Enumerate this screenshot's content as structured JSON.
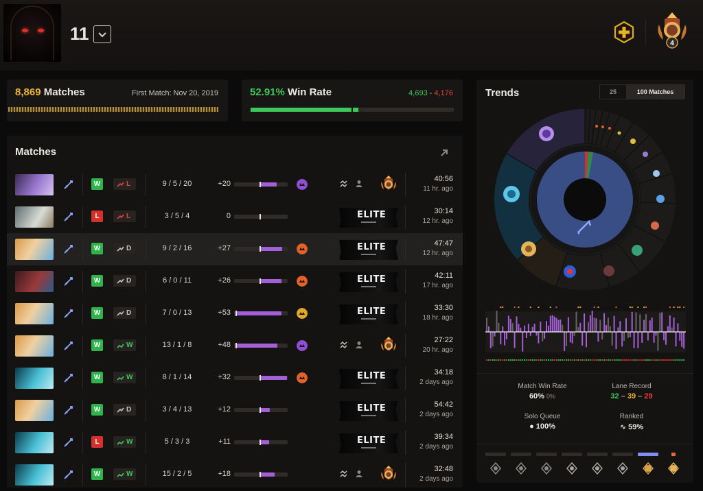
{
  "header": {
    "player_name": "11",
    "rank_number": "4"
  },
  "summary": {
    "matches_count": "8,869",
    "matches_label": " Matches",
    "first_match": "First Match: Nov 20, 2019",
    "win_rate": "52.91%",
    "win_rate_label": " Win Rate",
    "wins": "4,693",
    "losses": "4,176",
    "win_fraction": 0.5291
  },
  "matches": {
    "title": "Matches",
    "rows": [
      {
        "hero": "hero-a",
        "color": "#7a4bb3",
        "result": "W",
        "lane": "L",
        "lane_type": "loss",
        "kda": "9 / 5 / 20",
        "impact": "+20",
        "impact_value": 20,
        "role_color": "#8e4fd6",
        "mode": "party-ranked",
        "duration": "40:56",
        "ago": "11 hr. ago"
      },
      {
        "hero": "hero-b",
        "color": "#6e7f8c",
        "result": "L",
        "lane": "L",
        "lane_type": "loss",
        "kda": "3 / 5 / 4",
        "impact": "0",
        "impact_value": 0,
        "role_color": "",
        "mode": "elite",
        "duration": "30:14",
        "ago": "12 hr. ago"
      },
      {
        "hero": "hero-c",
        "color": "#c98a45",
        "result": "W",
        "lane": "D",
        "lane_type": "draw",
        "kda": "9 / 2 / 16",
        "impact": "+27",
        "impact_value": 27,
        "role_color": "#e2622a",
        "mode": "elite",
        "duration": "47:47",
        "ago": "12 hr. ago"
      },
      {
        "hero": "hero-d",
        "color": "#8a3a3a",
        "result": "W",
        "lane": "D",
        "lane_type": "draw",
        "kda": "6 / 0 / 11",
        "impact": "+26",
        "impact_value": 26,
        "role_color": "#e2622a",
        "mode": "elite",
        "duration": "42:11",
        "ago": "17 hr. ago"
      },
      {
        "hero": "hero-c",
        "color": "#c98a45",
        "result": "W",
        "lane": "D",
        "lane_type": "draw",
        "kda": "7 / 0 / 13",
        "impact": "+53",
        "impact_value": 53,
        "role_color": "#e0a82a",
        "mode": "elite",
        "duration": "33:30",
        "ago": "18 hr. ago"
      },
      {
        "hero": "hero-c",
        "color": "#c98a45",
        "result": "W",
        "lane": "W",
        "lane_type": "win",
        "kda": "13 / 1 / 8",
        "impact": "+48",
        "impact_value": 48,
        "role_color": "#8e4fd6",
        "mode": "party-ranked",
        "duration": "27:22",
        "ago": "20 hr. ago"
      },
      {
        "hero": "hero-e",
        "color": "#2a8fa8",
        "result": "W",
        "lane": "W",
        "lane_type": "win",
        "kda": "8 / 1 / 14",
        "impact": "+32",
        "impact_value": 32,
        "role_color": "#e2622a",
        "mode": "elite",
        "duration": "34:18",
        "ago": "2 days ago"
      },
      {
        "hero": "hero-c",
        "color": "#c98a45",
        "result": "W",
        "lane": "D",
        "lane_type": "draw",
        "kda": "3 / 4 / 13",
        "impact": "+12",
        "impact_value": 12,
        "role_color": "",
        "mode": "elite",
        "duration": "54:42",
        "ago": "2 days ago"
      },
      {
        "hero": "hero-e",
        "color": "#2a8fa8",
        "result": "L",
        "lane": "W",
        "lane_type": "win",
        "kda": "5 / 3 / 3",
        "impact": "+11",
        "impact_value": 11,
        "role_color": "",
        "mode": "elite",
        "duration": "39:34",
        "ago": "2 days ago"
      },
      {
        "hero": "hero-e",
        "color": "#2a8fa8",
        "result": "W",
        "lane": "W",
        "lane_type": "win",
        "kda": "15 / 2 / 5",
        "impact": "+18",
        "impact_value": 18,
        "role_color": "",
        "mode": "party-ranked",
        "duration": "32:48",
        "ago": "2 days ago"
      }
    ],
    "elite_text": "ELITE"
  },
  "trends": {
    "title": "Trends",
    "tab_25": "25",
    "tab_100": "100 Matches",
    "stats": {
      "match_win_rate_label": "Match Win Rate",
      "match_win_rate": "60%",
      "match_win_rate_sub": "0%",
      "lane_record_label": "Lane Record",
      "lane_w": "32",
      "lane_d": "39",
      "lane_l": "29",
      "solo_label": "Solo Queue",
      "solo_value": "100%",
      "ranked_label": "Ranked",
      "ranked_value": "59%"
    },
    "lane_separator": " – "
  }
}
